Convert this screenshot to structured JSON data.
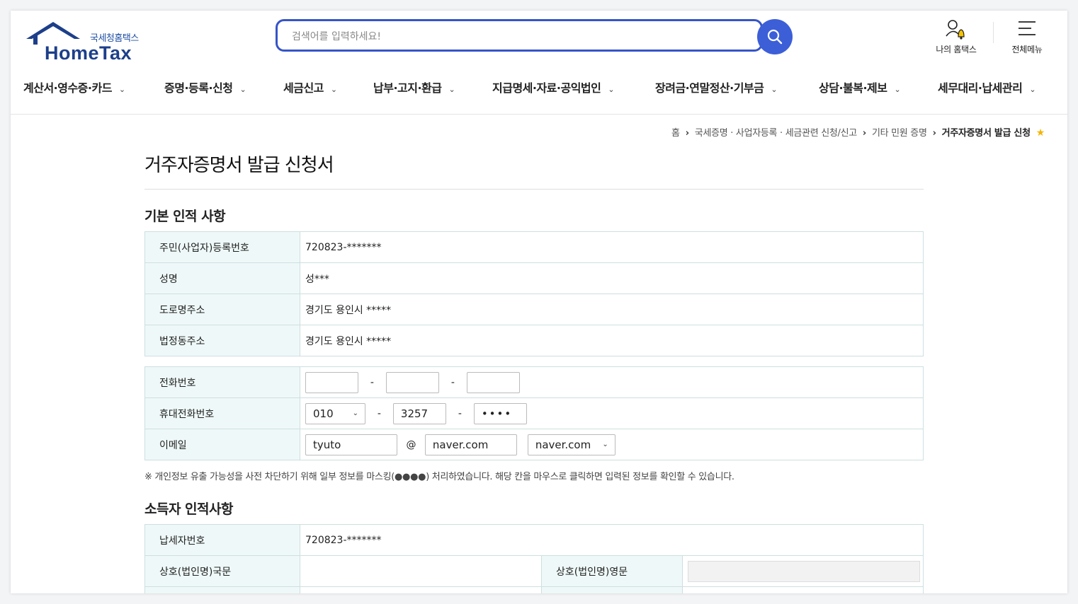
{
  "logo": {
    "sub_text": "국세청홈택스",
    "main_text": "HomeTax"
  },
  "search": {
    "placeholder": "검색어를 입력하세요!"
  },
  "utility": {
    "my_hometax": "나의 홈택스",
    "all_menu": "전체메뉴"
  },
  "gnb": [
    "계산서·영수증·카드",
    "증명·등록·신청",
    "세금신고",
    "납부·고지·환급",
    "지급명세·자료·공익법인",
    "장려금·연말정산·기부금",
    "상담·불복·제보",
    "세무대리·납세관리"
  ],
  "breadcrumb": {
    "home": "홈",
    "level1": "국세증명 · 사업자등록 · 세금관련 신청/신고",
    "level2": "기타 민원 증명",
    "current": "거주자증명서 발급 신청"
  },
  "page_title": "거주자증명서 발급 신청서",
  "section_basic": {
    "title": "기본 인적 사항",
    "rows": [
      {
        "label": "주민(사업자)등록번호",
        "value": "720823-*******"
      },
      {
        "label": "성명",
        "value": "성***"
      },
      {
        "label": "도로명주소",
        "value": "경기도 용인시 *****"
      },
      {
        "label": "법정동주소",
        "value": "경기도 용인시 *****"
      }
    ]
  },
  "contact": {
    "phone_label": "전화번호",
    "mobile_label": "휴대전화번호",
    "mobile_prefix": "010",
    "mobile_mid": "3257",
    "mobile_last": "••••",
    "email_label": "이메일",
    "email_id": "tyuto",
    "email_at": "@",
    "email_domain": "naver.com",
    "email_domain_select": "naver.com",
    "dash": "-"
  },
  "notice": "※ 개인정보 유출 가능성을 사전 차단하기 위해 일부 정보를 마스킹(●●●●) 처리하였습니다. 해당 칸을 마우스로 클릭하면 입력된 정보를 확인할 수 있습니다.",
  "section_income": {
    "title": "소득자 인적사항",
    "taxpayer_label": "납세자번호",
    "taxpayer_value": "720823-*******",
    "name_kr_label": "상호(법인명)국문",
    "name_en_label": "상호(법인명)영문"
  },
  "colors": {
    "accent": "#3654c8",
    "table_header_bg": "#eff8f8",
    "table_border": "#cddfe0",
    "star": "#f4b400"
  }
}
